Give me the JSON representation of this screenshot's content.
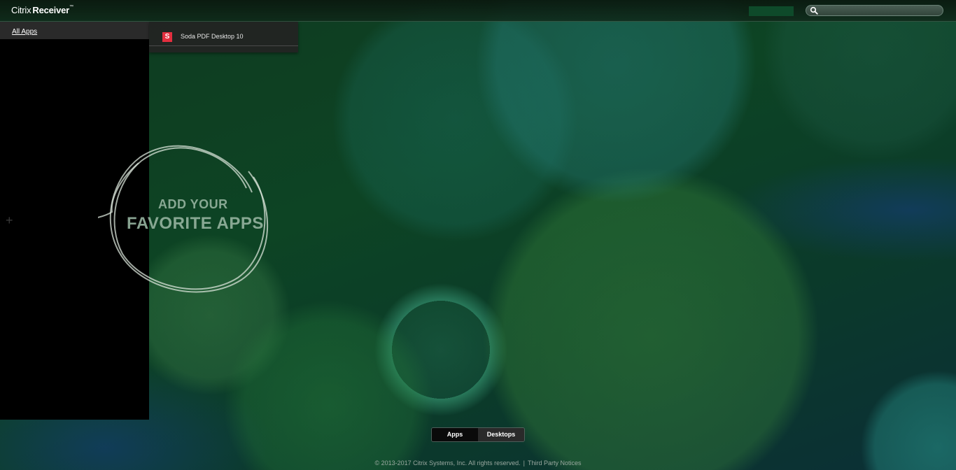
{
  "header": {
    "logo_part1": "Citrix",
    "logo_part2": "Receiver",
    "logo_tm": "™"
  },
  "search": {
    "value": "",
    "placeholder": ""
  },
  "sidebar": {
    "all_apps_label": "All Apps"
  },
  "dropdown": {
    "items": [
      {
        "icon_letter": "S",
        "label": "Soda PDF Desktop 10",
        "icon_color": "#e32f3f"
      }
    ]
  },
  "favorites": {
    "line1": "ADD YOUR",
    "line2": "FAVORITE APPS",
    "plus": "+"
  },
  "tabs": {
    "apps_label": "Apps",
    "desktops_label": "Desktops"
  },
  "footer": {
    "copyright": "© 2013-2017 Citrix Systems, Inc. All rights reserved.",
    "separator": "|",
    "third_party_label": "Third Party Notices"
  }
}
